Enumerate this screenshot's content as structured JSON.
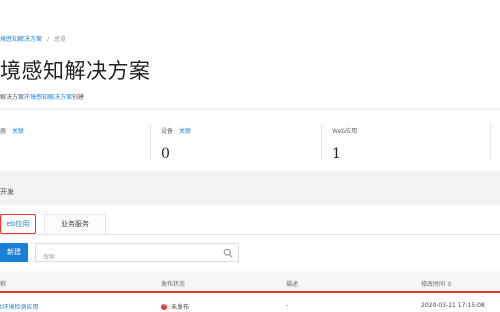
{
  "breadcrumb": {
    "parent": "境感知解决方案",
    "separator": "/",
    "current": "总览"
  },
  "page_title": "境感知解决方案",
  "subtitle": {
    "prefix": "解决方案",
    "link": "环境感知解决方案",
    "suffix": "创建"
  },
  "stats": [
    {
      "label": "器",
      "link": "关联",
      "value": ""
    },
    {
      "label": "设备",
      "link": "关联",
      "value": "0"
    },
    {
      "label": "Web应用",
      "link": "",
      "value": "1"
    }
  ],
  "dev_section_label": "开发",
  "tabs": [
    {
      "label": "eb应用",
      "active": true
    },
    {
      "label": "业务服务",
      "active": false
    }
  ],
  "toolbar": {
    "new_label": "新建",
    "search_placeholder": "搜索"
  },
  "table": {
    "headers": [
      "称",
      "发布状态",
      "描述",
      "修改时间 ⇕"
    ],
    "rows": [
      {
        "name": "t环境检测应用",
        "status": "未发布",
        "description": "-",
        "modified": "2020-03-11 17:15:08"
      }
    ]
  },
  "colors": {
    "accent": "#1a7fd6",
    "highlight": "#e53935",
    "status_unpublished": "#e53935"
  }
}
